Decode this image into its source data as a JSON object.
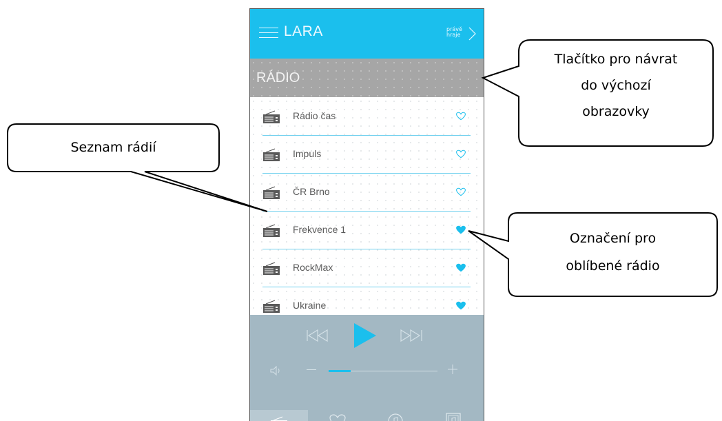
{
  "app": {
    "title": "LARA",
    "now_playing_line1": "právě",
    "now_playing_line2": "hraje"
  },
  "section": {
    "title": "RÁDIO"
  },
  "stations": [
    {
      "name": "Rádio čas",
      "favorite": false
    },
    {
      "name": "Impuls",
      "favorite": false
    },
    {
      "name": "ČR Brno",
      "favorite": false
    },
    {
      "name": "Frekvence 1",
      "favorite": true
    },
    {
      "name": "RockMax",
      "favorite": true
    },
    {
      "name": "Ukraine",
      "favorite": true
    }
  ],
  "player": {
    "volume_fraction": 0.2
  },
  "bottom_tabs": [
    {
      "icon": "radio-icon",
      "active": true
    },
    {
      "icon": "heart-icon",
      "active": false
    },
    {
      "icon": "music-note-circle-icon",
      "active": false
    },
    {
      "icon": "music-note-album-icon",
      "active": false
    }
  ],
  "callouts": {
    "back_button_line1": "Tlačítko pro návrat",
    "back_button_line2": "do výchozí",
    "back_button_line3": "obrazovky",
    "station_list": "Seznam rádií",
    "favorite_line1": "Označení pro",
    "favorite_line2": "oblíbené rádio"
  },
  "colors": {
    "accent": "#1bbfed",
    "header_gray": "#a6a6a6",
    "player_bg": "#a3b8c3",
    "divider": "#6fd0ee"
  }
}
